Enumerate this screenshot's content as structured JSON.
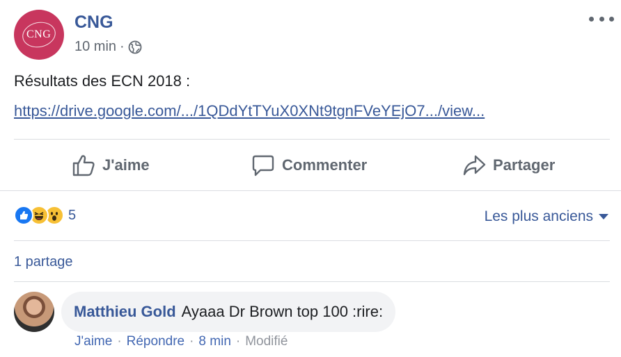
{
  "post": {
    "page_logo_text": "CNG",
    "page_name": "CNG",
    "time": "10 min",
    "separator": "·",
    "privacy_icon": "globe-icon",
    "text": "Résultats des ECN 2018 :",
    "link": "https://drive.google.com/.../1QDdYtTYuX0XNt9tgnFVeYEjO7.../view..."
  },
  "actions": {
    "like": "J'aime",
    "comment": "Commenter",
    "share": "Partager"
  },
  "reactions": {
    "types": [
      "like",
      "haha",
      "wow"
    ],
    "count": "5"
  },
  "sort": {
    "label": "Les plus anciens"
  },
  "shares": {
    "label": "1 partage"
  },
  "comment": {
    "author": "Matthieu Gold",
    "text": "Ayaaa Dr Brown top 100 :rire:",
    "like": "J'aime",
    "reply": "Répondre",
    "time": "8 min",
    "edited": "Modifié",
    "separator": "·"
  },
  "colors": {
    "brand": "#c8365e",
    "link": "#385898",
    "muted": "#606770",
    "bubble": "#f2f3f5",
    "like_blue": "#1877f2",
    "emoji_yellow": "#f7c035"
  }
}
